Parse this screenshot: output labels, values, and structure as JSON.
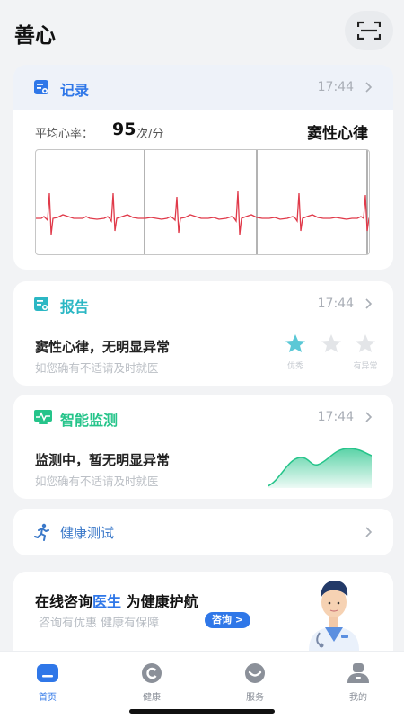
{
  "header": {
    "title": "善心"
  },
  "record": {
    "title": "记录",
    "time": "17:44",
    "avg_hr_label": "平均心率：",
    "avg_hr_value": "95",
    "avg_hr_unit": "次/分",
    "rhythm": "窦性心律"
  },
  "report": {
    "title": "报告",
    "time": "17:44",
    "result": "窦性心律，无明显异常",
    "advice": "如您确有不适请及时就医",
    "rating": {
      "filled": 1,
      "total": 3
    },
    "rating_labels": [
      "优秀",
      "",
      "有异常"
    ]
  },
  "monitor": {
    "title": "智能监测",
    "time": "17:44",
    "status": "监测中，暂无明显异常",
    "advice": "如您确有不适请及时就医"
  },
  "health_test": {
    "title": "健康测试"
  },
  "consult": {
    "title_prefix": "在线咨询",
    "title_highlight": "医生",
    "title_suffix": " 为健康护航",
    "subtitle": "咨询有优惠  健康有保障",
    "button": "咨询 >"
  },
  "tabbar": {
    "items": [
      {
        "label": "首页",
        "icon": "home-icon",
        "active": true
      },
      {
        "label": "健康",
        "icon": "health-icon",
        "active": false
      },
      {
        "label": "服务",
        "icon": "service-icon",
        "active": false
      },
      {
        "label": "我的",
        "icon": "profile-icon",
        "active": false
      }
    ]
  },
  "colors": {
    "accent": "#2f77e8",
    "report_teal": "#2bb7c4",
    "monitor_green": "#25c48a",
    "ecg_red": "#e03a4a",
    "star_active": "#5bc8d6",
    "star_inactive": "#e3e5e8"
  }
}
